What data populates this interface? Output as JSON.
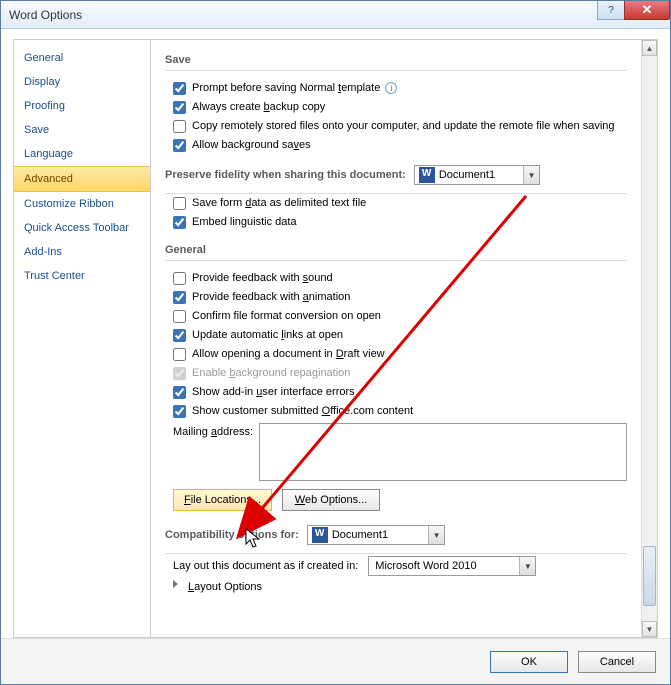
{
  "window": {
    "title": "Word Options"
  },
  "titlebar": {
    "help_glyph": "?",
    "close_glyph": "✕"
  },
  "sidebar": {
    "items": [
      {
        "label": "General"
      },
      {
        "label": "Display"
      },
      {
        "label": "Proofing"
      },
      {
        "label": "Save"
      },
      {
        "label": "Language"
      },
      {
        "label": "Advanced"
      },
      {
        "label": "Customize Ribbon"
      },
      {
        "label": "Quick Access Toolbar"
      },
      {
        "label": "Add-Ins"
      },
      {
        "label": "Trust Center"
      }
    ],
    "selected": "Advanced"
  },
  "sections": {
    "save": {
      "title": "Save",
      "opts": {
        "prompt_normal": {
          "pre": "Prompt before saving Normal ",
          "u": "t",
          "post": "emplate",
          "checked": true,
          "info": true
        },
        "backup_copy": {
          "pre": "Always create ",
          "u": "b",
          "post": "ackup copy",
          "checked": true
        },
        "copy_remote": {
          "text": "Copy remotely stored files onto your computer, and update the remote file when saving",
          "checked": false
        },
        "bg_saves": {
          "pre": "Allow background sa",
          "u": "v",
          "post": "es",
          "checked": true
        }
      }
    },
    "preserve": {
      "title": "Preserve fidelity when sharing this document:",
      "doc_name": "Document1",
      "opts": {
        "save_form_data": {
          "pre": "Save form ",
          "u": "d",
          "post": "ata as delimited text file",
          "checked": false
        },
        "embed_ling": {
          "text": "Embed linguistic data",
          "checked": true
        }
      }
    },
    "general": {
      "title": "General",
      "opts": {
        "fb_sound": {
          "pre": "Provide feedback with ",
          "u": "s",
          "post": "ound",
          "checked": false
        },
        "fb_anim": {
          "pre": "Provide feedback with ",
          "u": "a",
          "post": "nimation",
          "checked": true
        },
        "confirm_conv": {
          "text": "Confirm file format conversion on open",
          "checked": false
        },
        "upd_links": {
          "pre": "Update automatic ",
          "u": "l",
          "post": "inks at open",
          "checked": true
        },
        "draft_view": {
          "pre": "Allow opening a document in ",
          "u": "D",
          "post": "raft view",
          "checked": false
        },
        "bg_repag": {
          "pre": "Enable ",
          "u": "b",
          "post": "ackground repagination",
          "checked": true,
          "disabled": true
        },
        "addin_err": {
          "pre": "Show add-in ",
          "u": "u",
          "post": "ser interface errors",
          "checked": true
        },
        "office_com": {
          "pre": "Show customer submitted ",
          "u": "O",
          "post": "ffice.com content",
          "checked": true
        }
      },
      "mailing_label_pre": "Mailing ",
      "mailing_label_u": "a",
      "mailing_label_post": "ddress:",
      "mailing_value": "",
      "btn_file_loc_pre": "",
      "btn_file_loc_u": "F",
      "btn_file_loc_post": "ile Locations...",
      "btn_web_opt_pre": "",
      "btn_web_opt_u": "W",
      "btn_web_opt_post": "eb Options..."
    },
    "compat": {
      "title": "Compatibility options for:",
      "doc_name": "Document1",
      "layout_label": "Lay out this document as if created in:",
      "layout_value": "Microsoft Word 2010",
      "layout_opts_pre": "",
      "layout_opts_u": "L",
      "layout_opts_post": "ayout Options"
    }
  },
  "footer": {
    "ok": "OK",
    "cancel": "Cancel"
  }
}
